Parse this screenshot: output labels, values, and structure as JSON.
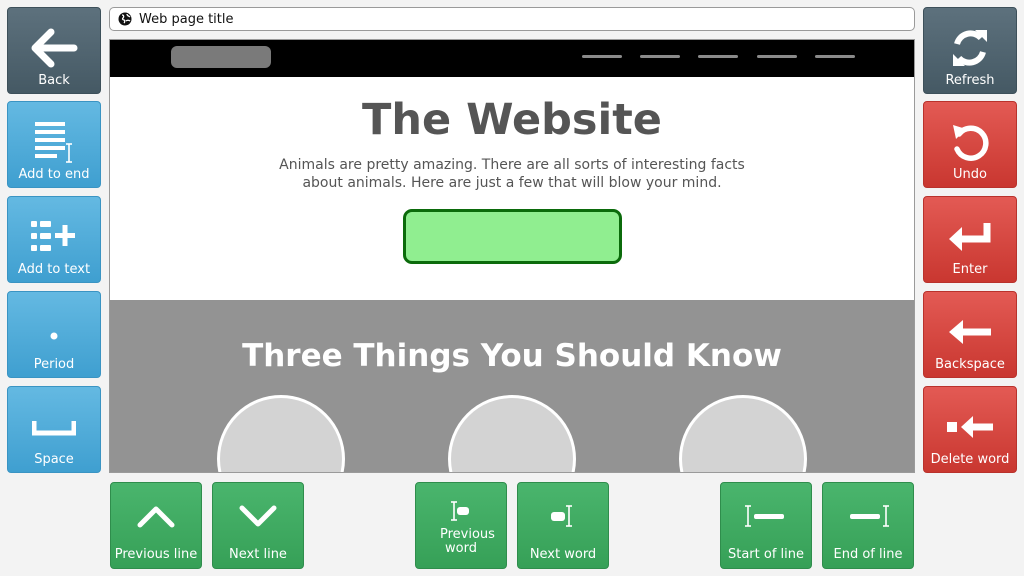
{
  "left_panel": {
    "back": "Back",
    "add_to_end": "Add to end",
    "add_to_text": "Add to text",
    "period": "Period",
    "space": "Space"
  },
  "right_panel": {
    "refresh": "Refresh",
    "undo": "Undo",
    "enter": "Enter",
    "backspace": "Backspace",
    "delete_word": "Delete word"
  },
  "bottom_bar": {
    "previous_line": "Previous line",
    "next_line": "Next line",
    "previous_word": "Previous word",
    "next_word": "Next word",
    "start_of_line": "Start of line",
    "end_of_line": "End of line"
  },
  "browser": {
    "page_title": "Web page title",
    "title_icon": "globe-icon"
  },
  "website": {
    "heading": "The Website",
    "intro": "Animals are pretty amazing.  There are all sorts of interesting facts about animals.  Here are just a few that will blow your mind.",
    "section_heading": "Three Things You Should Know",
    "colors": {
      "navbar": "#000000",
      "button_fill": "#90ee90",
      "button_border": "#0b6b0b",
      "section_bg": "#939393"
    }
  },
  "colors": {
    "slate": "#4f636e",
    "blue": "#4faad8",
    "red": "#d4443e",
    "green": "#3eaa5f"
  }
}
